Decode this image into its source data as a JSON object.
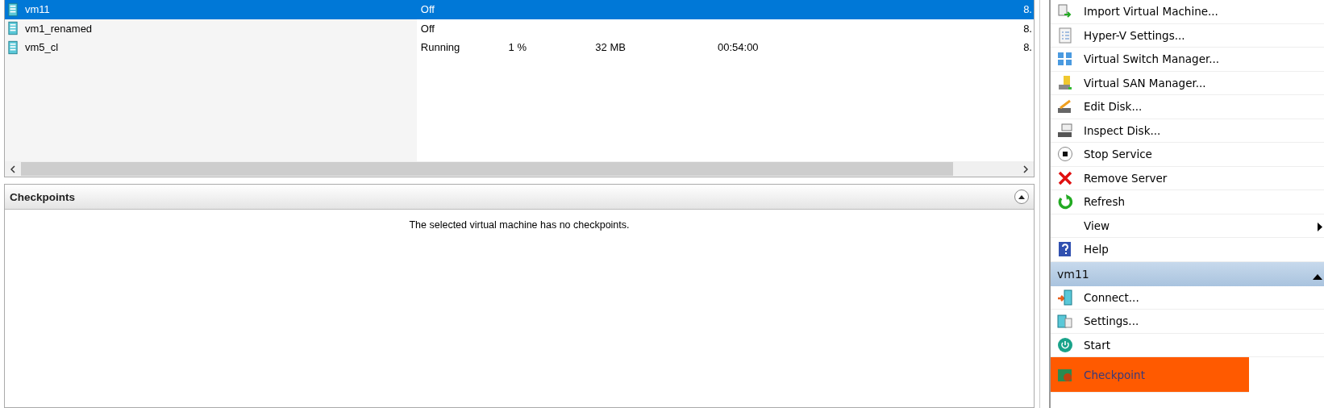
{
  "vm_table": {
    "rows": [
      {
        "name": "vm11",
        "state": "Off",
        "column_6": "8.",
        "selected": true
      },
      {
        "name": "vm1_renamed",
        "state": "Off",
        "column_6": "8.",
        "selected": false
      },
      {
        "name": "vm5_cl",
        "state": "Running",
        "cpu": "1 %",
        "memory": "32 MB",
        "uptime": "00:54:00",
        "column_6": "8.",
        "selected": false
      }
    ]
  },
  "checkpoints": {
    "title": "Checkpoints",
    "message": "The selected virtual machine has no checkpoints."
  },
  "actions": {
    "items": [
      {
        "label": "Import Virtual Machine...",
        "highlighted": false
      },
      {
        "label": "Hyper-V Settings...",
        "highlighted": false
      },
      {
        "label": "Virtual Switch Manager...",
        "highlighted": false
      },
      {
        "label": "Virtual SAN Manager...",
        "highlighted": false
      },
      {
        "label": "Edit Disk...",
        "highlighted": false
      },
      {
        "label": "Inspect Disk...",
        "highlighted": false
      },
      {
        "label": "Stop Service",
        "highlighted": false
      },
      {
        "label": "Remove Server",
        "highlighted": false
      },
      {
        "label": "Refresh",
        "highlighted": false
      },
      {
        "label": "View",
        "submenu": true,
        "highlighted": false
      },
      {
        "label": "Help",
        "highlighted": false
      }
    ],
    "vm_section": {
      "title": "vm11",
      "expanded": true,
      "items": [
        {
          "label": "Connect...",
          "highlighted": false
        },
        {
          "label": "Settings...",
          "highlighted": false
        },
        {
          "label": "Start",
          "highlighted": false
        },
        {
          "label": "Checkpoint",
          "highlighted": true
        }
      ]
    }
  }
}
